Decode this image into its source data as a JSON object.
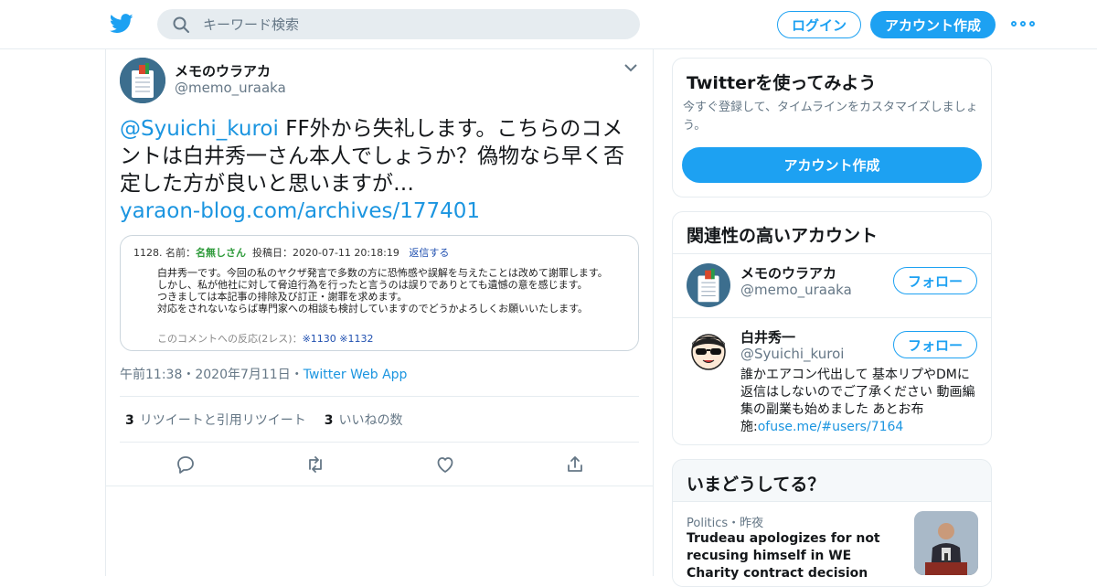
{
  "header": {
    "search_placeholder": "キーワード検索",
    "login_label": "ログイン",
    "signup_label": "アカウント作成"
  },
  "tweet": {
    "author_name": "メモのウラアカ",
    "author_handle": "@memo_uraaka",
    "mention": "@Syuichi_kuroi",
    "text": " FF外から失礼します。こちらのコメントは白井秀一さん本人でしょうか？偽物なら早く否定した方が良いと思いますが…",
    "link": "yaraon-blog.com/archives/177401",
    "card": {
      "head_prefix": "1128. 名前：",
      "head_name": "名無しさん",
      "head_date": "投稿日：2020-07-11 20:18:19",
      "head_reply": "返信する",
      "body": "白井秀一です。今回の私のヤクザ発言で多数の方に恐怖感や誤解を与えたことは改めて謝罪します。\nしかし、私が他社に対して脅迫行為を行ったと言うのは誤りでありとても遺憾の意を感じます。\nつきましては本記事の排除及び訂正・謝罪を求めます。\n対応をされないならば専門家への相談も検討していますのでどうかよろしくお願いいたします。",
      "foot_prefix": "このコメントへの反応(2レス)：",
      "foot_links": "※1130 ※1132"
    },
    "time": "午前11:38",
    "date": "2020年7月11日",
    "source": "Twitter Web App",
    "retweets_count": "3",
    "retweets_label": "リツイートと引用リツイート",
    "likes_count": "3",
    "likes_label": "いいねの数"
  },
  "sidebar": {
    "signup_card": {
      "title": "Twitterを使ってみよう",
      "desc": "今すぐ登録して、タイムラインをカスタマイズしましょう。",
      "button": "アカウント作成"
    },
    "related": {
      "title": "関連性の高いアカウント",
      "follow_label": "フォロー",
      "accounts": [
        {
          "name": "メモのウラアカ",
          "handle": "@memo_uraaka"
        },
        {
          "name": "白井秀一",
          "handle": "@Syuichi_kuroi",
          "bio": "誰かエアコン代出して 基本リプやDMに返信はしないのでご了承ください 動画編集の副業も始めました あとお布施:",
          "bio_link": "ofuse.me/#users/7164"
        }
      ]
    },
    "trends": {
      "title": "いまどうしてる？",
      "items": [
        {
          "category": "Politics・昨夜",
          "title": "Trudeau apologizes for not recusing himself in WE Charity contract decision"
        }
      ]
    }
  }
}
